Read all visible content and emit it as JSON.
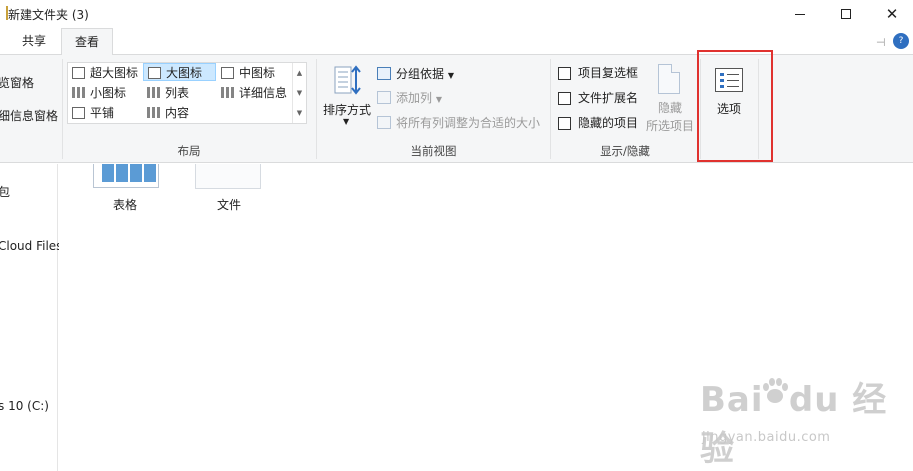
{
  "window": {
    "title": "新建文件夹 (3)"
  },
  "tabs": {
    "share": "共享",
    "view": "查看"
  },
  "ribbon": {
    "pane_group": {
      "item1": "览窗格",
      "item2": "细信息窗格"
    },
    "layout_group": {
      "label": "布局",
      "items": {
        "extra_large_icons": "超大图标",
        "large_icons": "大图标",
        "medium_icons": "中图标",
        "small_icons": "小图标",
        "list": "列表",
        "details": "详细信息",
        "tiles": "平铺",
        "content": "内容"
      },
      "selected": "大图标"
    },
    "current_view_group": {
      "label": "当前视图",
      "sort_by": "排序方式",
      "group_by": "分组依据",
      "add_columns": "添加列",
      "size_all_columns": "将所有列调整为合适的大小"
    },
    "show_hide_group": {
      "label": "显示/隐藏",
      "item_check_boxes": "项目复选框",
      "file_name_extensions": "文件扩展名",
      "hidden_items": "隐藏的项目",
      "hide_selected_line1": "隐藏",
      "hide_selected_line2": "所选项目",
      "checkboxes_checked": [
        false,
        false,
        false
      ]
    },
    "options": {
      "label": "选项"
    }
  },
  "nav_pane": {
    "items": [
      "包",
      "Cloud Files",
      "s 10 (C:)"
    ]
  },
  "content": {
    "files": [
      {
        "name": "表格",
        "type": "spreadsheet"
      },
      {
        "name": "文件",
        "type": "document"
      }
    ]
  },
  "watermark": {
    "logo": "Bai  经验",
    "url": "jingyan.baidu.com"
  },
  "colors": {
    "ribbon_bg": "#f5f6f7",
    "selected_bg": "#cce8ff",
    "highlight_border": "#e0322f",
    "accent_blue": "#2f6fc0"
  }
}
